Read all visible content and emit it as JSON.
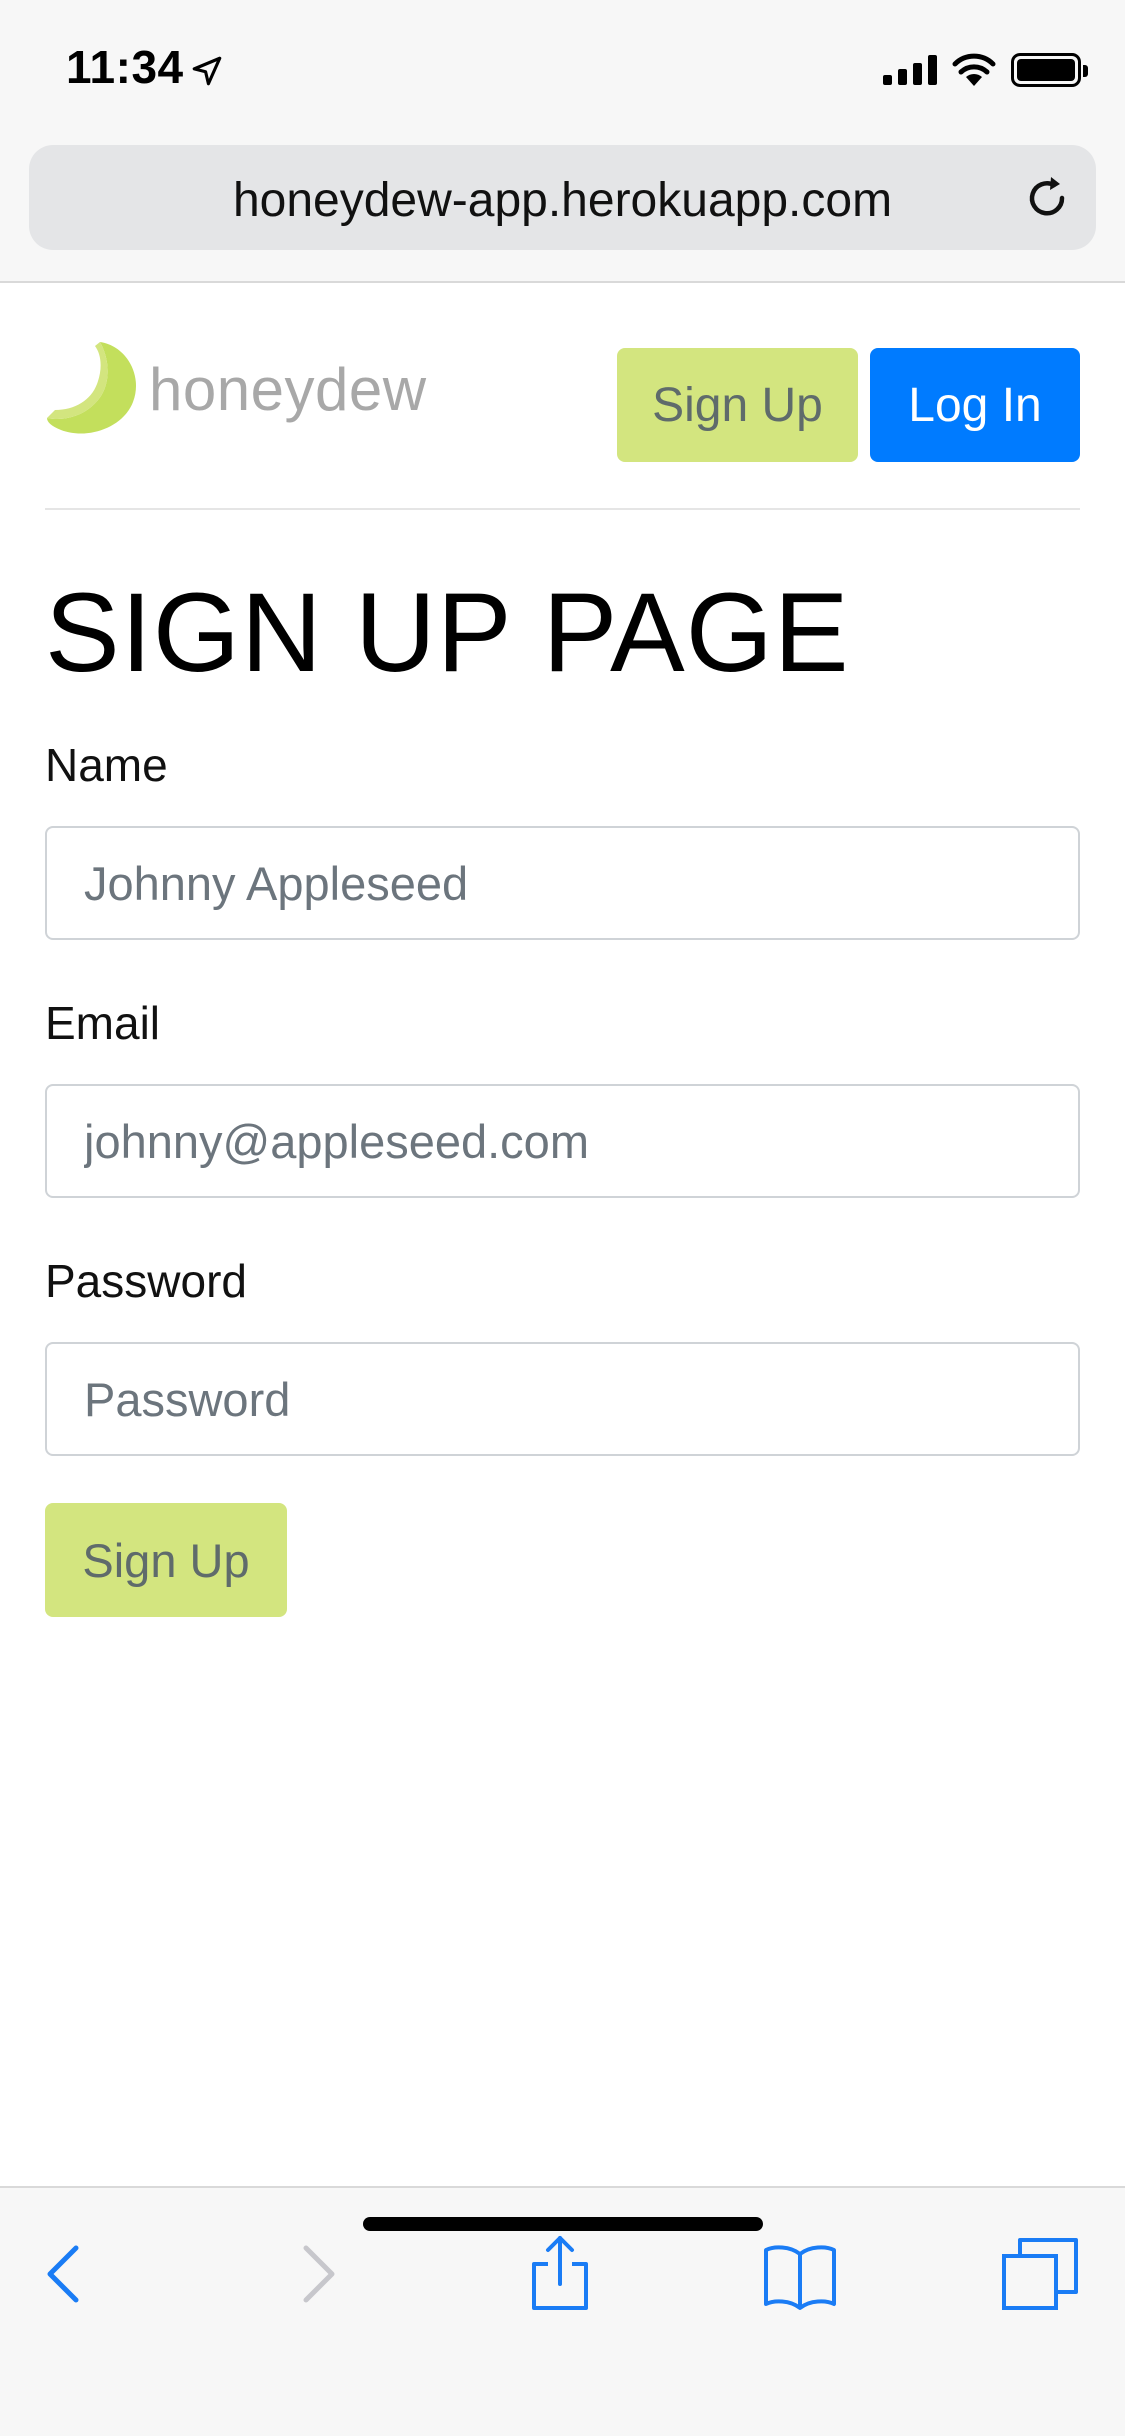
{
  "status_bar": {
    "time": "11:34"
  },
  "browser": {
    "url": "honeydew-app.herokuapp.com"
  },
  "header": {
    "logo_text": "honeydew",
    "signup_label": "Sign Up",
    "login_label": "Log In"
  },
  "page": {
    "title": "SIGN UP PAGE"
  },
  "form": {
    "name": {
      "label": "Name",
      "value": "",
      "placeholder": "Johnny Appleseed"
    },
    "email": {
      "label": "Email",
      "value": "",
      "placeholder": "johnny@appleseed.com"
    },
    "password": {
      "label": "Password",
      "value": "",
      "placeholder": "Password"
    },
    "submit_label": "Sign Up"
  },
  "colors": {
    "accent_green": "#d3e57f",
    "primary_blue": "#007bff",
    "safari_blue": "#1a7cf5"
  },
  "toolbar": {
    "icons": [
      "back-icon",
      "forward-icon",
      "share-icon",
      "bookmarks-icon",
      "tabs-icon"
    ]
  }
}
